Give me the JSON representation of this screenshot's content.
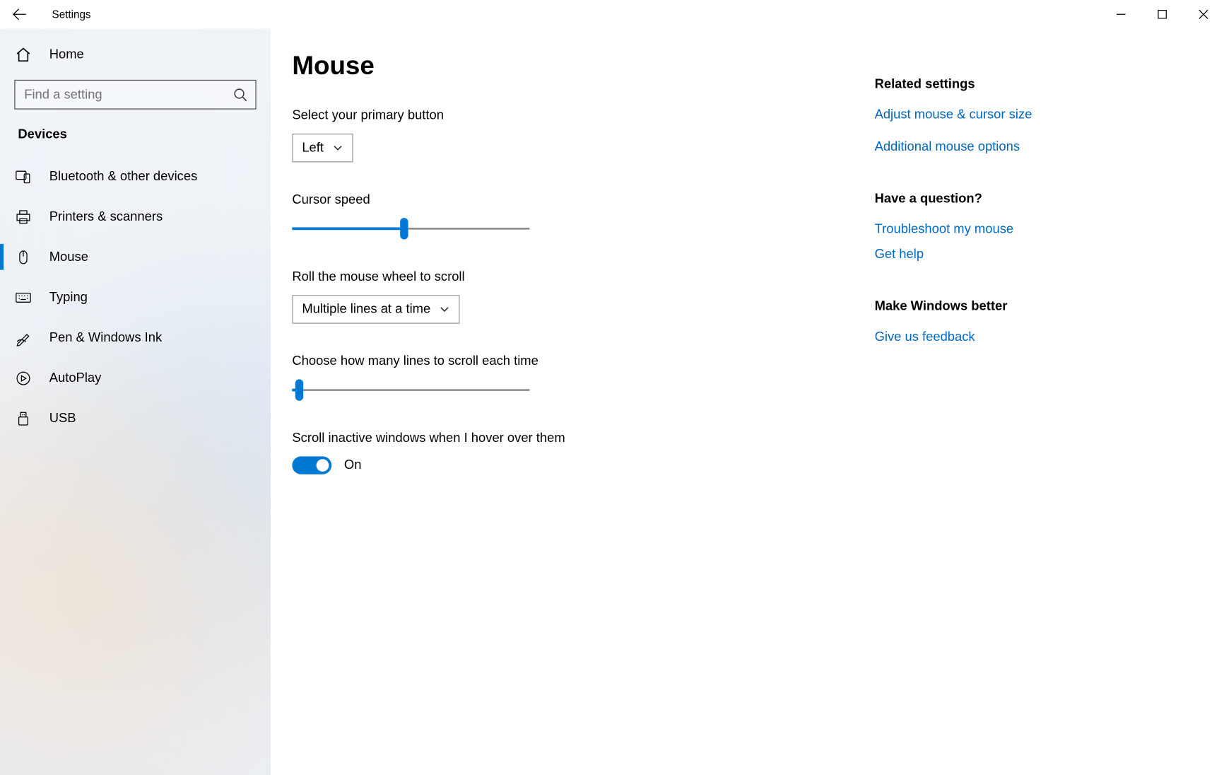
{
  "window": {
    "title": "Settings"
  },
  "sidebar": {
    "home": "Home",
    "search_placeholder": "Find a setting",
    "category": "Devices",
    "items": [
      {
        "label": "Bluetooth & other devices"
      },
      {
        "label": "Printers & scanners"
      },
      {
        "label": "Mouse"
      },
      {
        "label": "Typing"
      },
      {
        "label": "Pen & Windows Ink"
      },
      {
        "label": "AutoPlay"
      },
      {
        "label": "USB"
      }
    ]
  },
  "page": {
    "title": "Mouse",
    "primary_label": "Select your primary button",
    "primary_value": "Left",
    "cursor_speed_label": "Cursor speed",
    "cursor_speed_value": 47,
    "scroll_mode_label": "Roll the mouse wheel to scroll",
    "scroll_mode_value": "Multiple lines at a time",
    "lines_label": "Choose how many lines to scroll each time",
    "lines_value": 3,
    "inactive_label": "Scroll inactive windows when I hover over them",
    "inactive_on": true,
    "inactive_text": "On"
  },
  "right": {
    "related_heading": "Related settings",
    "related_links": [
      "Adjust mouse & cursor size",
      "Additional mouse options"
    ],
    "question_heading": "Have a question?",
    "question_links": [
      "Troubleshoot my mouse",
      "Get help"
    ],
    "better_heading": "Make Windows better",
    "better_links": [
      "Give us feedback"
    ]
  }
}
